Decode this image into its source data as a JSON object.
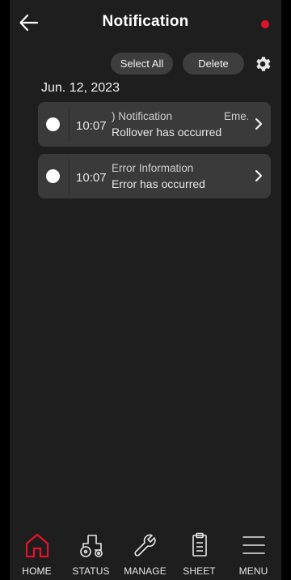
{
  "header": {
    "title": "Notification",
    "back_icon": "arrow-left-icon",
    "indicator_color": "#e4132b"
  },
  "actions": {
    "select_all_label": "Select All",
    "delete_label": "Delete",
    "settings_icon": "gear-icon"
  },
  "date_label": "Jun. 12, 2023",
  "notifications": [
    {
      "time": "10:07",
      "title": ") Notification",
      "tag": "Eme...",
      "message": "Rollover has occurred"
    },
    {
      "time": "10:07",
      "title": "Error Information",
      "tag": "",
      "message": "Error has occurred"
    }
  ],
  "nav": [
    {
      "label": "HOME",
      "icon": "home-icon",
      "active": true
    },
    {
      "label": "STATUS",
      "icon": "tractor-icon",
      "active": false
    },
    {
      "label": "MANAGE",
      "icon": "wrench-icon",
      "active": false
    },
    {
      "label": "SHEET",
      "icon": "clipboard-icon",
      "active": false
    },
    {
      "label": "MENU",
      "icon": "menu-icon",
      "active": false
    }
  ],
  "colors": {
    "accent": "#e4132b",
    "background": "#1e1e1e",
    "card": "#3a3a3a",
    "pill": "#3e3e3e"
  }
}
